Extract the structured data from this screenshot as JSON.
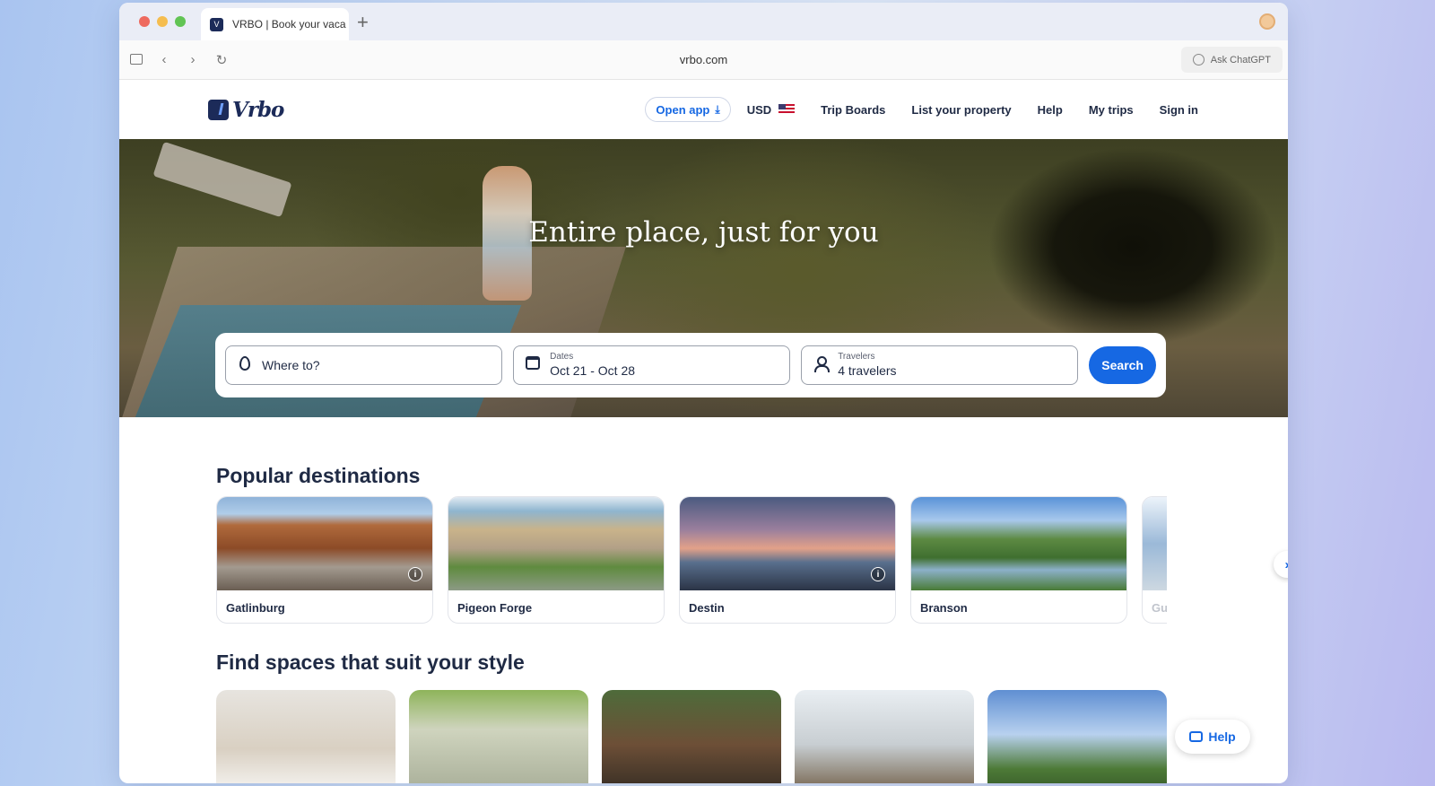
{
  "browser": {
    "tab_title": "VRBO | Book your vaca",
    "new_tab": "+",
    "url": "vrbo.com",
    "ask_chatgpt": "Ask ChatGPT"
  },
  "header": {
    "logo": "Vrbo",
    "open_app": "Open app",
    "currency": "USD",
    "nav": [
      "Trip Boards",
      "List your property",
      "Help",
      "My trips",
      "Sign in"
    ]
  },
  "hero": {
    "title": "Entire place, just for you",
    "where_placeholder": "Where to?",
    "dates_label": "Dates",
    "dates_value": "Oct 21 - Oct 28",
    "travelers_label": "Travelers",
    "travelers_value": "4 travelers",
    "search_button": "Search"
  },
  "popular": {
    "title": "Popular destinations",
    "destinations": [
      "Gatlinburg",
      "Pigeon Forge",
      "Destin",
      "Branson",
      "Gu"
    ]
  },
  "styles": {
    "title": "Find spaces that suit your style"
  },
  "help_button": "Help",
  "colors": {
    "brand_navy": "#1c2b59",
    "accent_blue": "#1668e3"
  }
}
